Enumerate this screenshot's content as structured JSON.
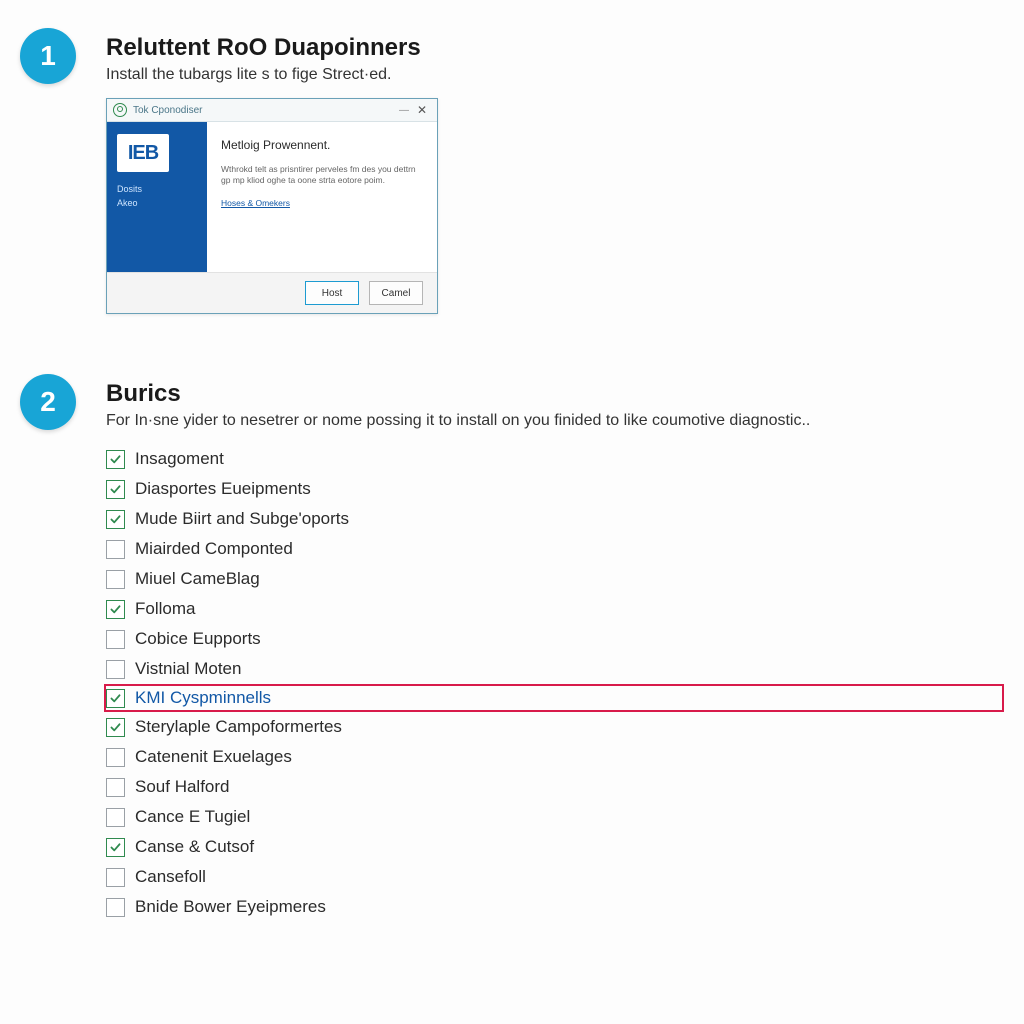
{
  "step1": {
    "num": "1",
    "title": "Reluttent RoO Duapoinners",
    "sub": "Install the tubargs lite s to fige Strect·ed.",
    "dialog": {
      "title": "Tok Cponodiser",
      "logo": "IEB",
      "left_links": [
        "Dosits",
        "Akeo"
      ],
      "heading": "Metloig Prowennent.",
      "body": "Wthrokd telt as prisntirer perveles fm des you dettrn gp mp kliod oghe ta oone strta eotore poim.",
      "link": "Hoses & Omekers",
      "btn_primary": "Host",
      "btn_cancel": "Camel"
    }
  },
  "step2": {
    "num": "2",
    "title": "Burics",
    "sub": "For In·sne yider to nesetrer or nome possing it to install on you finided to like coumotive diagnostic..",
    "items": [
      {
        "label": "Insagoment",
        "checked": true,
        "highlight": false
      },
      {
        "label": "Diasportes Eueipments",
        "checked": true,
        "highlight": false
      },
      {
        "label": "Mude Biirt and Subge'oports",
        "checked": true,
        "highlight": false
      },
      {
        "label": "Miairded Componted",
        "checked": false,
        "highlight": false
      },
      {
        "label": "Miuel CameBlag",
        "checked": false,
        "highlight": false
      },
      {
        "label": "Folloma",
        "checked": true,
        "highlight": false
      },
      {
        "label": "Cobice Eupports",
        "checked": false,
        "highlight": false
      },
      {
        "label": "Vistnial Moten",
        "checked": false,
        "highlight": false
      },
      {
        "label": "KMI Cyspminnells",
        "checked": true,
        "highlight": true
      },
      {
        "label": "Sterylaple Campoformertes",
        "checked": true,
        "highlight": false
      },
      {
        "label": "Catenenit Exuelages",
        "checked": false,
        "highlight": false
      },
      {
        "label": "Souf Halford",
        "checked": false,
        "highlight": false
      },
      {
        "label": "Cance E Tugiel",
        "checked": false,
        "highlight": false
      },
      {
        "label": "Canse & Cutsof",
        "checked": true,
        "highlight": false
      },
      {
        "label": "Cansefoll",
        "checked": false,
        "highlight": false
      },
      {
        "label": "Bnide Bower Eyeipmeres",
        "checked": false,
        "highlight": false
      }
    ]
  }
}
